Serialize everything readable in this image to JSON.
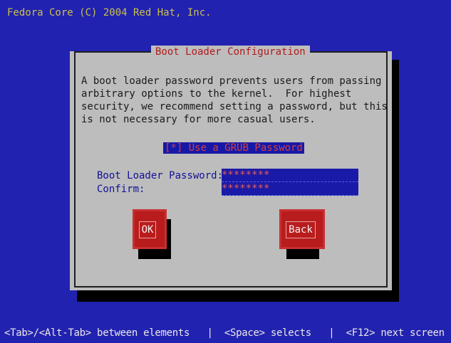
{
  "top_banner": "Fedora Core (C) 2004 Red Hat, Inc.",
  "dialog": {
    "title": "Boot Loader Configuration",
    "body_lines": [
      "A boot loader password prevents users from passing",
      "arbitrary options to the kernel.  For highest",
      "security, we recommend setting a password, but this",
      "is not necessary for more casual users."
    ],
    "checkbox": {
      "text": "[*] Use a GRUB Password",
      "checked": true
    },
    "password_label": "Boot Loader Password:",
    "password_value": "********",
    "confirm_label": "Confirm:",
    "confirm_value": "********",
    "ok_label": "OK",
    "back_label": "Back"
  },
  "help_line": "<Tab>/<Alt-Tab> between elements   |  <Space> selects   |  <F12> next screen",
  "colors": {
    "background": "#2222b0",
    "dialog": "#bdbdbd",
    "accent_red": "#b81c1c",
    "field_blue": "#1a1aa8"
  }
}
